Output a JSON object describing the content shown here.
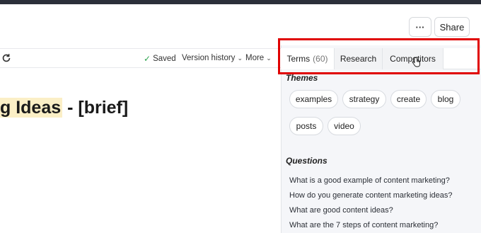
{
  "header": {
    "more_label": "···",
    "share_label": "Share"
  },
  "toolbar": {
    "saved_label": "Saved",
    "version_history_label": "Version history",
    "more_label": "More"
  },
  "document": {
    "title_highlight": "g Ideas",
    "title_rest": " - [brief]"
  },
  "sidebar": {
    "tabs": [
      {
        "label": "Terms",
        "count": "(60)"
      },
      {
        "label": "Research"
      },
      {
        "label": "Competitors"
      }
    ],
    "themes_heading": "Themes",
    "themes": [
      "examples",
      "strategy",
      "create",
      "blog",
      "posts",
      "video"
    ],
    "questions_heading": "Questions",
    "questions": [
      "What is a good example of content marketing?",
      "How do you generate content marketing ideas?",
      "What are good content ideas?",
      "What are the 7 steps of content marketing?"
    ]
  },
  "colors": {
    "highlight": "#fbefc6",
    "annotation_box": "#e00000",
    "saved_check": "#2ea44f"
  }
}
